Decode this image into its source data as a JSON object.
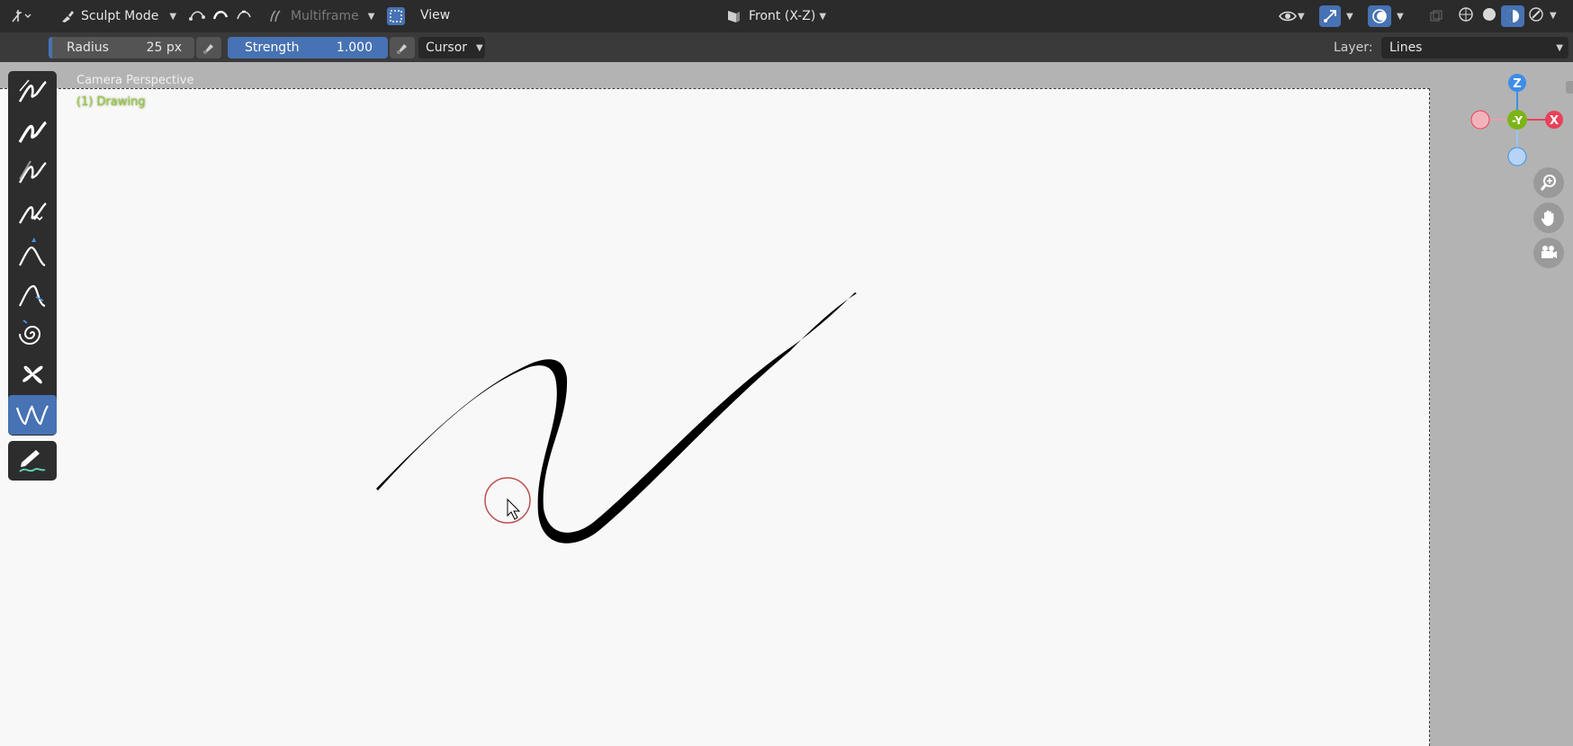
{
  "header": {
    "mode_label": "Sculpt Mode",
    "multiframe_label": "Multiframe",
    "view_menu": "View",
    "view_label": "Front (X-Z)"
  },
  "tool_settings": {
    "radius_label": "Radius",
    "radius_value": "25 px",
    "strength_label": "Strength",
    "strength_value": "1.000",
    "falloff_label": "Cursor",
    "layer_label": "Layer:",
    "layer_value": "Lines"
  },
  "viewport": {
    "perspective_label": "Camera Perspective",
    "object_label": "(1) Drawing"
  },
  "gizmo": {
    "z_label": "Z",
    "y_label": "-Y",
    "x_label": "X"
  },
  "toolbar": {
    "tools": [
      "smooth-tool",
      "thickness-tool",
      "strength-tool",
      "randomize-tool",
      "grab-tool",
      "push-tool",
      "twist-tool",
      "pinch-tool",
      "clone-tool"
    ],
    "active_tool": "clone-tool"
  },
  "colors": {
    "accent": "#4772b3",
    "header_bg": "#2b2b2b",
    "canvas_bg": "#f8f8f8",
    "object_label": "#9bc84a",
    "axis_z": "#3d8ee8",
    "axis_y": "#7cb518",
    "axis_x": "#e8415a"
  }
}
